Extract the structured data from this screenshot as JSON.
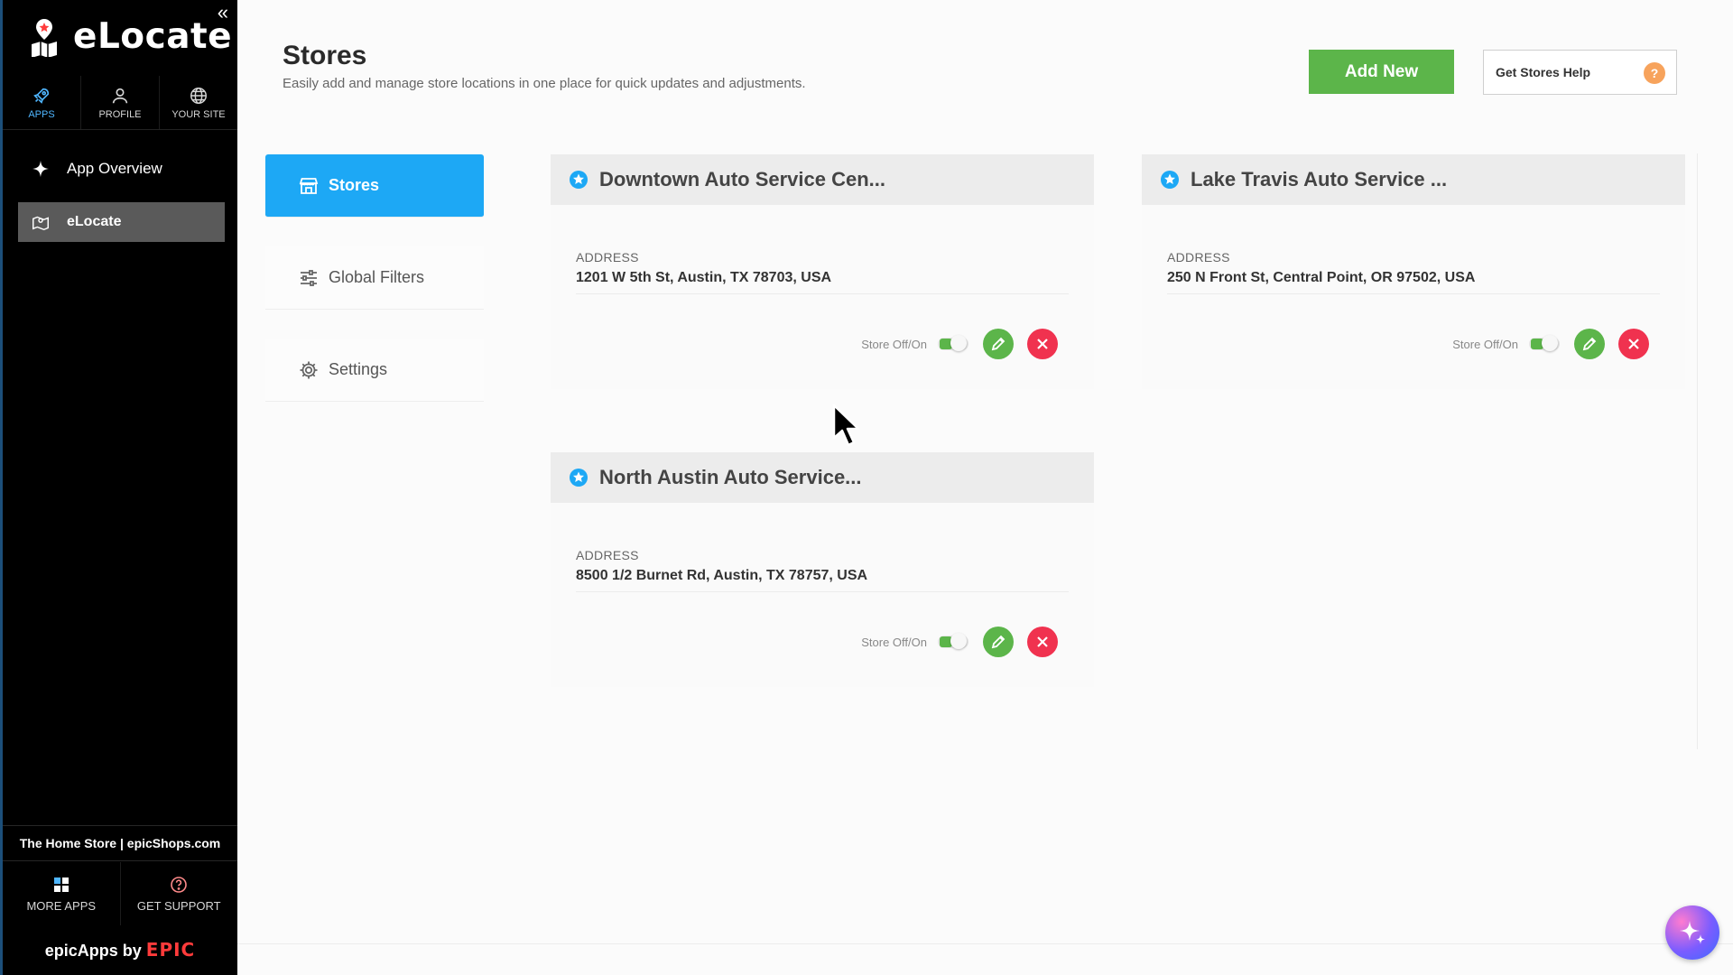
{
  "sidebar": {
    "brand": "eLocate",
    "top_tabs": [
      {
        "label": "APPS",
        "icon": "rocket-icon"
      },
      {
        "label": "PROFILE",
        "icon": "user-icon"
      },
      {
        "label": "YOUR SITE",
        "icon": "globe-icon"
      }
    ],
    "nav": [
      {
        "label": "App Overview",
        "icon": "sparkle-icon"
      },
      {
        "label": "eLocate",
        "icon": "map-icon"
      }
    ],
    "store_link": "The Home Store | epicShops.com",
    "bottom_tabs": [
      {
        "label": "MORE APPS",
        "icon": "grid-icon"
      },
      {
        "label": "GET SUPPORT",
        "icon": "help-circle-icon"
      }
    ],
    "footer_prefix": "epicApps by",
    "footer_brand": "EPIC"
  },
  "header": {
    "title": "Stores",
    "subtitle": "Easily add and manage store locations in one place for quick updates and adjustments.",
    "add_label": "Add New",
    "help_label": "Get Stores Help",
    "help_badge": "?"
  },
  "sub_nav": [
    {
      "label": "Stores",
      "icon": "store-icon",
      "active": true
    },
    {
      "label": "Global Filters",
      "icon": "sliders-icon"
    },
    {
      "label": "Settings",
      "icon": "gear-icon"
    }
  ],
  "stores": [
    {
      "name": "Downtown Auto Service Cen...",
      "address_label": "ADDRESS",
      "address": "1201 W 5th St, Austin, TX 78703, USA",
      "toggle_label": "Store Off/On",
      "enabled": true
    },
    {
      "name": "Lake Travis Auto Service ...",
      "address_label": "ADDRESS",
      "address": "250 N Front St, Central Point, OR 97502, USA",
      "toggle_label": "Store Off/On",
      "enabled": true
    },
    {
      "name": "North Austin Auto Service...",
      "address_label": "ADDRESS",
      "address": "8500 1/2 Burnet Rd, Austin, TX 78757, USA",
      "toggle_label": "Store Off/On",
      "enabled": true
    }
  ],
  "colors": {
    "primary": "#1da8f5",
    "success": "#5cb54a",
    "danger": "#f0324f",
    "help_badge": "#f7a35c",
    "sidebar_bg": "#000000"
  }
}
